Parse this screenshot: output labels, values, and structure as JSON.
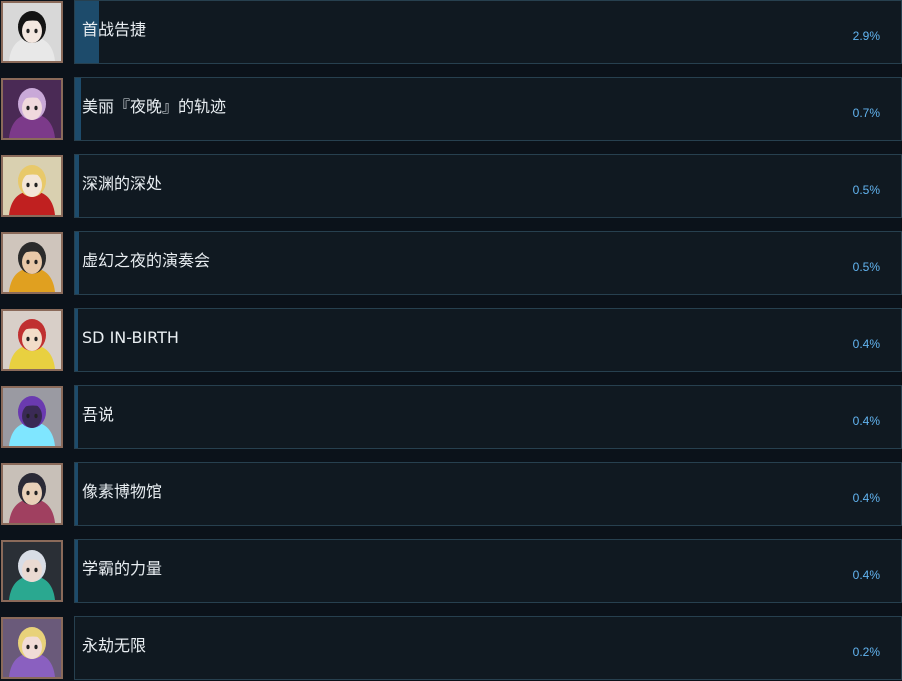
{
  "achievements": [
    {
      "title": "首战告捷",
      "percent_label": "2.9%",
      "percent": 2.9,
      "icon": "dark-haired-girl-portrait-icon",
      "colors": {
        "bg": "#d8d8d8",
        "skin": "#f3e7e0",
        "hair": "#141414",
        "accent": "#e8e8e8"
      }
    },
    {
      "title": "美丽『夜晚』的轨迹",
      "percent_label": "0.7%",
      "percent": 0.7,
      "icon": "purple-hat-girl-portrait-icon",
      "colors": {
        "bg": "#4a2a55",
        "skin": "#f0d9dd",
        "hair": "#c9a9d8",
        "accent": "#7c3a8a"
      }
    },
    {
      "title": "深渊的深处",
      "percent_label": "0.5%",
      "percent": 0.5,
      "icon": "blonde-girl-portrait-icon",
      "colors": {
        "bg": "#d9d0b0",
        "skin": "#f3e6d8",
        "hair": "#e8c96a",
        "accent": "#c02020"
      }
    },
    {
      "title": "虚幻之夜的演奏会",
      "percent_label": "0.5%",
      "percent": 0.5,
      "icon": "character-group-portrait-icon",
      "colors": {
        "bg": "#cfc5bc",
        "skin": "#e8c8a8",
        "hair": "#2b2b2b",
        "accent": "#e0a020"
      }
    },
    {
      "title": "SD IN-BIRTH",
      "percent_label": "0.4%",
      "percent": 0.4,
      "icon": "chibi-characters-portrait-icon",
      "colors": {
        "bg": "#d8cfc8",
        "skin": "#f2dcc8",
        "hair": "#c03030",
        "accent": "#e8d040"
      }
    },
    {
      "title": "吾说",
      "percent_label": "0.4%",
      "percent": 0.4,
      "icon": "purple-creature-portrait-icon",
      "colors": {
        "bg": "#9a9aa2",
        "skin": "#3a2a55",
        "hair": "#6a3ab0",
        "accent": "#7fe6ff"
      }
    },
    {
      "title": "像素博物馆",
      "percent_label": "0.4%",
      "percent": 0.4,
      "icon": "pixel-crowd-portrait-icon",
      "colors": {
        "bg": "#c8c0b8",
        "skin": "#e8d0b8",
        "hair": "#2a2a36",
        "accent": "#a04060"
      }
    },
    {
      "title": "学霸的力量",
      "percent_label": "0.4%",
      "percent": 0.4,
      "icon": "silver-haired-boy-portrait-icon",
      "colors": {
        "bg": "#2a2f36",
        "skin": "#eadad2",
        "hair": "#d8dde6",
        "accent": "#2aa890"
      }
    },
    {
      "title": "永劫无限",
      "percent_label": "0.2%",
      "percent": 0.2,
      "icon": "blonde-woman-portrait-icon",
      "colors": {
        "bg": "#6a5a7a",
        "skin": "#f1dcd6",
        "hair": "#e8d27a",
        "accent": "#8a60c0"
      }
    }
  ]
}
